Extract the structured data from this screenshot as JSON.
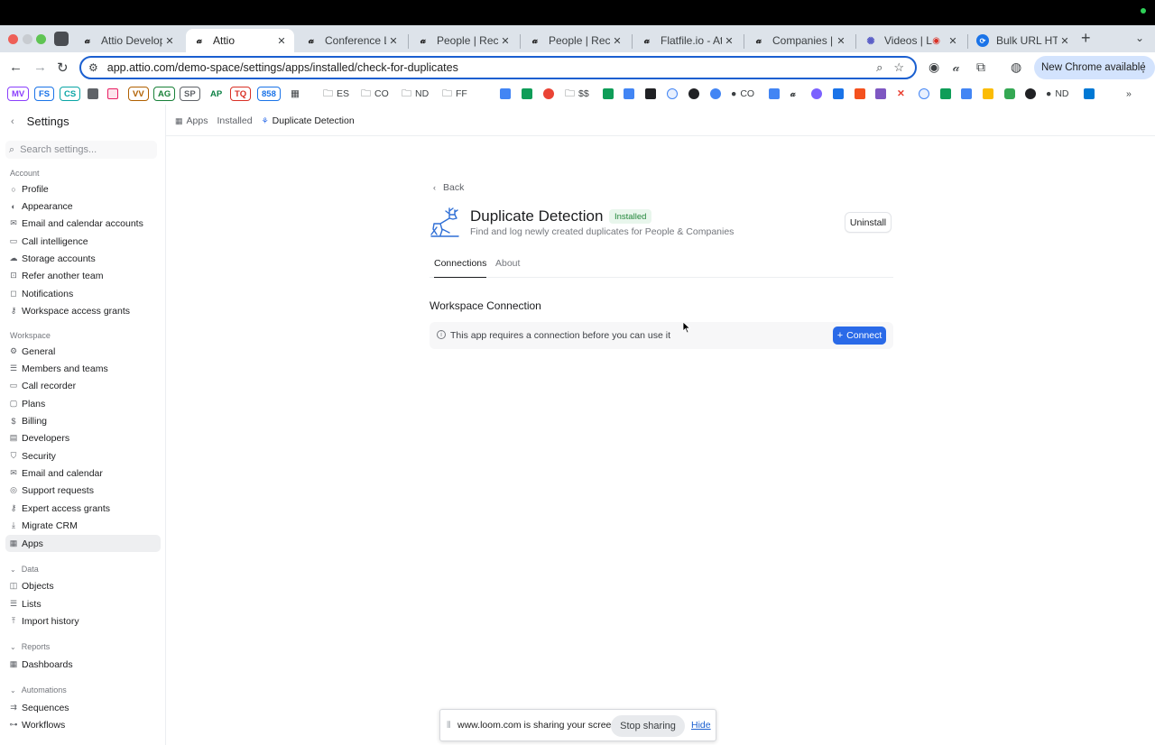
{
  "browser": {
    "tabs": [
      {
        "label": "Attio Developer P",
        "active": false
      },
      {
        "label": "Attio",
        "active": true
      },
      {
        "label": "Conference List",
        "active": false
      },
      {
        "label": "People | Recently",
        "active": false
      },
      {
        "label": "People | Recently",
        "active": false
      },
      {
        "label": "Flatfile.io - Attio",
        "active": false
      },
      {
        "label": "Companies | All",
        "active": false
      },
      {
        "label": "Videos | Libra",
        "active": false
      },
      {
        "label": "Bulk URL HTTP S",
        "active": false
      }
    ],
    "url": "app.attio.com/demo-space/settings/apps/installed/check-for-duplicates",
    "new_chrome_label": "New Chrome available",
    "bookmarks": {
      "badges": [
        "MV",
        "FS",
        "CS",
        "VV",
        "AG",
        "SP",
        "AP",
        "TQ",
        "858"
      ],
      "folders": [
        "ES",
        "CO",
        "ND",
        "FF",
        "$$"
      ],
      "labeled_links": [
        "CO",
        "ND"
      ]
    }
  },
  "sidebar": {
    "title": "Settings",
    "search_placeholder": "Search settings...",
    "sections": [
      {
        "label": "Account",
        "items": [
          "Profile",
          "Appearance",
          "Email and calendar accounts",
          "Call intelligence",
          "Storage accounts",
          "Refer another team",
          "Notifications",
          "Workspace access grants"
        ]
      },
      {
        "label": "Workspace",
        "items": [
          "General",
          "Members and teams",
          "Call recorder",
          "Plans",
          "Billing",
          "Developers",
          "Security",
          "Email and calendar",
          "Support requests",
          "Expert access grants",
          "Migrate CRM",
          "Apps"
        ]
      },
      {
        "label": "Data",
        "items": [
          "Objects",
          "Lists",
          "Import history"
        ]
      },
      {
        "label": "Reports",
        "items": [
          "Dashboards"
        ]
      },
      {
        "label": "Automations",
        "items": [
          "Sequences",
          "Workflows"
        ]
      }
    ],
    "active_item": "Apps"
  },
  "breadcrumb": {
    "apps": "Apps",
    "installed": "Installed",
    "current": "Duplicate Detection"
  },
  "app_page": {
    "back_label": "Back",
    "title": "Duplicate Detection",
    "status_badge": "Installed",
    "subtitle": "Find and log newly created duplicates for People & Companies",
    "uninstall_label": "Uninstall",
    "tabs": [
      "Connections",
      "About"
    ],
    "active_tab": "Connections",
    "workspace_connection_title": "Workspace Connection",
    "connection_message": "This app requires a connection before you can use it",
    "connect_label": "Connect"
  },
  "loom_bar": {
    "message": "www.loom.com is sharing your screen.",
    "stop_label": "Stop sharing",
    "hide_label": "Hide"
  },
  "colors": {
    "accent": "#2a6ae8",
    "installed_bg": "#e8f6ec",
    "installed_text": "#22863a",
    "omnibox_border": "#1a5fd0"
  }
}
